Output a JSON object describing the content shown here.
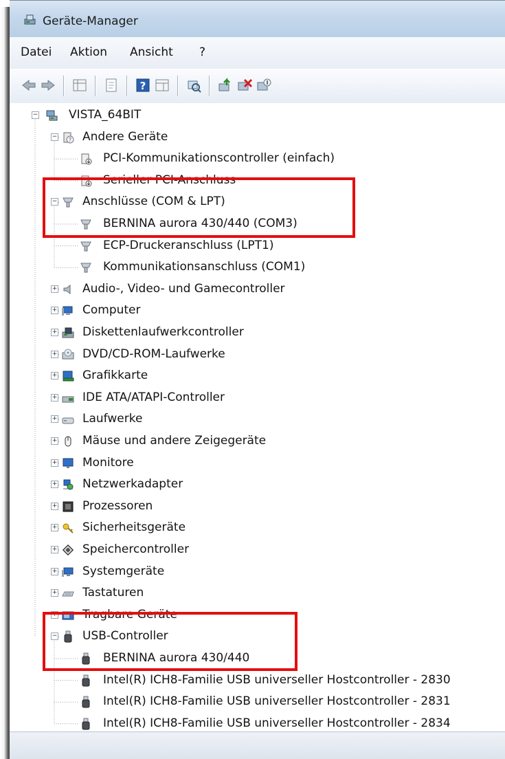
{
  "window": {
    "title": "Geräte-Manager"
  },
  "menu": [
    "Datei",
    "Aktion",
    "Ansicht",
    "?"
  ],
  "toolbar": [
    "back-icon",
    "forward-icon",
    "properties-grid-icon",
    "show-hidden-icon",
    "help-icon",
    "view-icon",
    "scan-hardware-icon",
    "update-driver-icon",
    "uninstall-icon",
    "disable-icon"
  ],
  "tree": {
    "root": "VISTA_64BIT",
    "items": [
      {
        "label": "Andere Geräte",
        "icon": "other-devices-icon",
        "expanded": true,
        "children": [
          {
            "label": "PCI-Kommunikationscontroller (einfach)",
            "icon": "unknown-device-icon"
          },
          {
            "label": "Serieller PCI-Anschluss",
            "icon": "unknown-device-icon"
          }
        ]
      },
      {
        "label": "Anschlüsse (COM & LPT)",
        "icon": "port-icon",
        "expanded": true,
        "children": [
          {
            "label": "BERNINA aurora 430/440 (COM3)",
            "icon": "port-icon"
          },
          {
            "label": "ECP-Druckeranschluss (LPT1)",
            "icon": "port-icon"
          },
          {
            "label": "Kommunikationsanschluss (COM1)",
            "icon": "port-icon"
          }
        ]
      },
      {
        "label": "Audio-, Video- und Gamecontroller",
        "icon": "audio-icon"
      },
      {
        "label": "Computer",
        "icon": "computer-icon"
      },
      {
        "label": "Diskettenlaufwerkcontroller",
        "icon": "floppy-controller-icon"
      },
      {
        "label": "DVD/CD-ROM-Laufwerke",
        "icon": "dvd-icon"
      },
      {
        "label": "Grafikkarte",
        "icon": "display-adapter-icon"
      },
      {
        "label": "IDE ATA/ATAPI-Controller",
        "icon": "ide-icon"
      },
      {
        "label": "Laufwerke",
        "icon": "disk-drive-icon"
      },
      {
        "label": "Mäuse und andere Zeigegeräte",
        "icon": "mouse-icon"
      },
      {
        "label": "Monitore",
        "icon": "monitor-icon"
      },
      {
        "label": "Netzwerkadapter",
        "icon": "network-adapter-icon"
      },
      {
        "label": "Prozessoren",
        "icon": "processor-icon"
      },
      {
        "label": "Sicherheitsgeräte",
        "icon": "security-device-icon"
      },
      {
        "label": "Speichercontroller",
        "icon": "storage-controller-icon"
      },
      {
        "label": "Systemgeräte",
        "icon": "system-devices-icon"
      },
      {
        "label": "Tastaturen",
        "icon": "keyboard-icon"
      },
      {
        "label": "Tragbare Geräte",
        "icon": "portable-devices-icon"
      },
      {
        "label": "USB-Controller",
        "icon": "usb-icon",
        "expanded": true,
        "children": [
          {
            "label": "BERNINA aurora 430/440",
            "icon": "usb-icon"
          },
          {
            "label": "Intel(R) ICH8-Familie USB universeller Hostcontroller - 2830",
            "icon": "usb-icon"
          },
          {
            "label": "Intel(R) ICH8-Familie USB universeller Hostcontroller - 2831",
            "icon": "usb-icon"
          },
          {
            "label": "Intel(R) ICH8-Familie USB universeller Hostcontroller - 2834",
            "icon": "usb-icon"
          }
        ]
      }
    ]
  },
  "colors": {
    "highlight": "#e30f0f",
    "titlebar": "#c5d8ec"
  }
}
